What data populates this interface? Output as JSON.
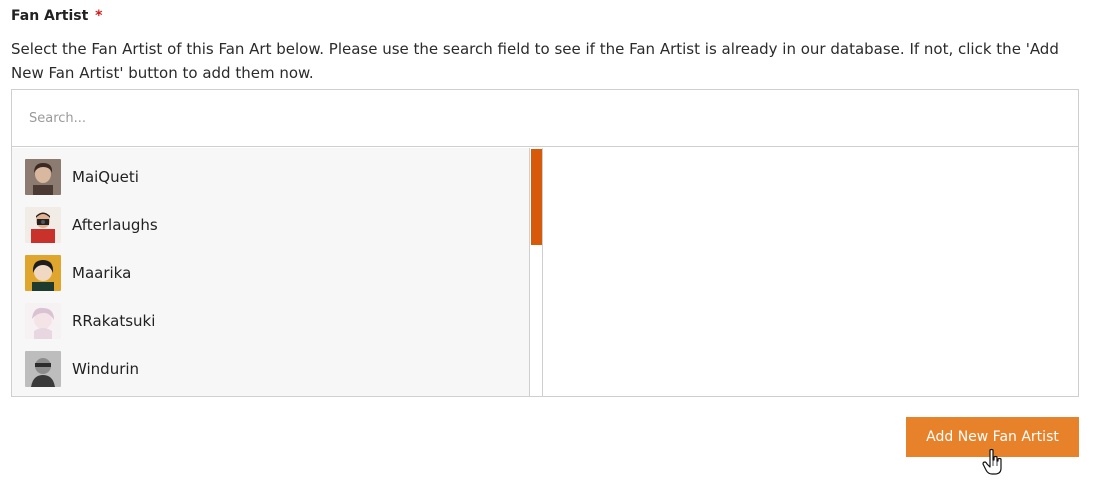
{
  "field": {
    "label": "Fan Artist",
    "required_mark": "*",
    "description": "Select the Fan Artist of this Fan Art below. Please use the search field to see if the Fan Artist is already in our database. If not, click the 'Add New Fan Artist' button to add them now."
  },
  "search": {
    "placeholder": "Search..."
  },
  "artists": [
    {
      "name": "MaiQueti"
    },
    {
      "name": "Afterlaughs"
    },
    {
      "name": "Maarika"
    },
    {
      "name": "RRakatsuki"
    },
    {
      "name": "Windurin"
    }
  ],
  "buttons": {
    "add_new": "Add New Fan Artist"
  },
  "colors": {
    "accent": "#e8822a",
    "scroll_thumb": "#d75a0a",
    "required": "#d11a1a"
  }
}
